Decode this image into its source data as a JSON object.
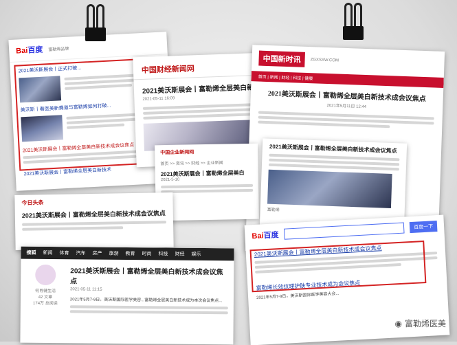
{
  "sheet1": {
    "baidu_logo": "Bai百度",
    "section": "富勒烯品牌",
    "headline_1": "2021美沃斯展会丨正式打破...",
    "headline_2": "美沃斯丨看医美新赛道与富勒烯如何打破...",
    "headline_3": "2021美沃斯展会丨富勒烯全层美白新技术成会议焦点",
    "headline_4": "2021美沃斯展会丨富勒烯全层美白新技术",
    "snippet": "2021美沃斯展会丨富勒烯全层..."
  },
  "sheet2": {
    "logo": "中国财经新闻网",
    "title": "2021美沃斯展会丨富勒烯全层美白新",
    "meta": "2021-05-11 16:09"
  },
  "sheet3": {
    "logo": "中国新时讯",
    "url": "ZGXSXW.COM",
    "nav": "首页 | 新闻 | 财经 | 科技 | 健康",
    "title": "2021美沃斯展会丨富勒烯全层美白新技术成会议焦点",
    "date": "2021年5月11日 12:44",
    "sub_title": "2021美沃斯展会丨富勒烯全层美白新技术成会议焦点",
    "tag": "富勒烯"
  },
  "sheet4": {
    "logo": "中国企业新闻网",
    "breadcrumb": "首页 >> 资讯 >> 财经 >> 企业新闻",
    "title": "2021美沃斯展会丨富勒烯全层美白",
    "date": "2021-5-10"
  },
  "sheet5": {
    "logo": "今日头条",
    "title": "2021美沃斯展会丨富勒烯全层美白新技术成会议焦点"
  },
  "sheet6": {
    "site": "搜狐",
    "nav": [
      "新闻",
      "体育",
      "汽车",
      "房产",
      "旅游",
      "教育",
      "时尚",
      "科技",
      "财经",
      "娱乐"
    ],
    "title": "2021美沃斯展会丨富勒烯全层美白新技术成会议焦点",
    "date": "2021-05-11 11:15",
    "author": "何肖健生活",
    "stats": [
      "42 文章",
      "174万 总阅读"
    ],
    "body": "2021年5月7-9日，美沃斯国际医学美容...富勒烯全层美白新技术成为本次会议焦点..."
  },
  "sheet7": {
    "baidu_logo": "Bai百度",
    "search_button": "百度一下",
    "result_1": "2021美沃斯展会丨富勒烯全层美白新技术成会议焦点",
    "result_2": "富勒烯长效纹理护肤专业技术成为会议焦点",
    "snippet": "2021年5月7-9日，美沃斯国际医学美容大会..."
  },
  "watermark": "富勒烯医美",
  "colors": {
    "accent_red": "#d42323",
    "baidu_red": "#e10602",
    "baidu_blue": "#2932e1"
  }
}
